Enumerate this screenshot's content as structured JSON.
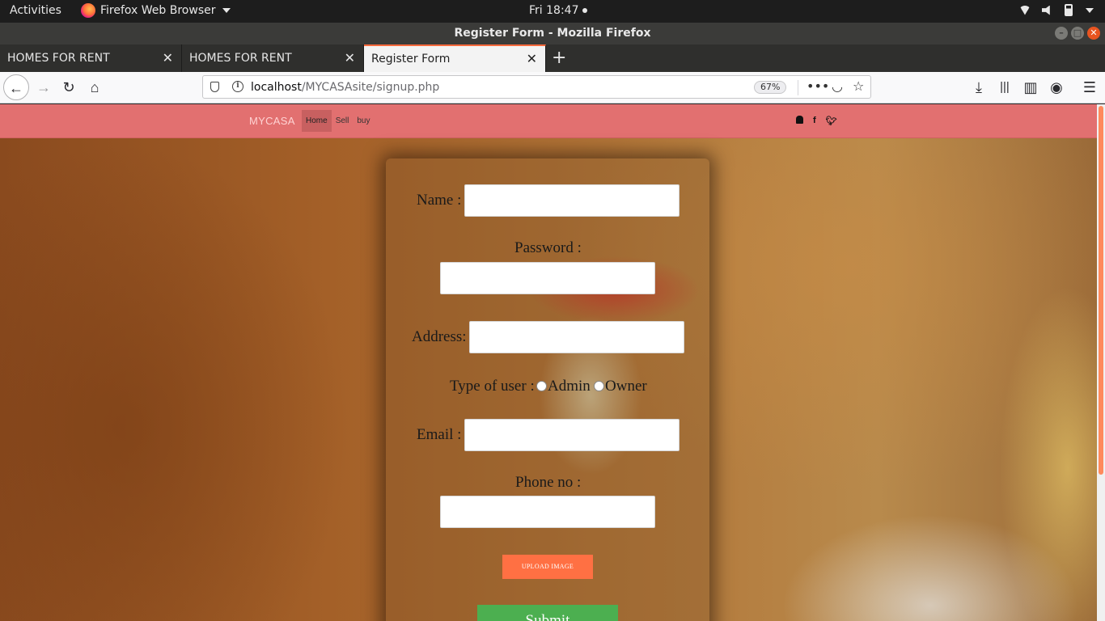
{
  "system": {
    "activities": "Activities",
    "app_name": "Firefox Web Browser",
    "clock": "Fri 18:47"
  },
  "window": {
    "title": "Register Form - Mozilla Firefox"
  },
  "tabs": [
    {
      "label": "HOMES FOR RENT",
      "active": false
    },
    {
      "label": "HOMES FOR RENT",
      "active": false
    },
    {
      "label": "Register Form",
      "active": true
    }
  ],
  "urlbar": {
    "host": "localhost",
    "path": "/MYCASAsite/signup.php",
    "zoom": "67%"
  },
  "site": {
    "brand": "MYCASA",
    "menu": [
      "Home",
      "Sell",
      "buy"
    ],
    "active_menu": "Home",
    "social": [
      "bell-icon",
      "facebook-icon",
      "twitter-icon"
    ],
    "accent_color": "#e27070"
  },
  "form": {
    "name_label": "Name :",
    "password_label": "Password :",
    "address_label": "Address:",
    "user_type_label": "Type of user :",
    "user_type_options": [
      "Admin",
      "Owner"
    ],
    "email_label": "Email :",
    "phone_label": "Phone no :",
    "upload_label": "UPLOAD IMAGE",
    "submit_label": "Submit",
    "upload_color": "#ff7043",
    "submit_color": "#4caf50"
  }
}
